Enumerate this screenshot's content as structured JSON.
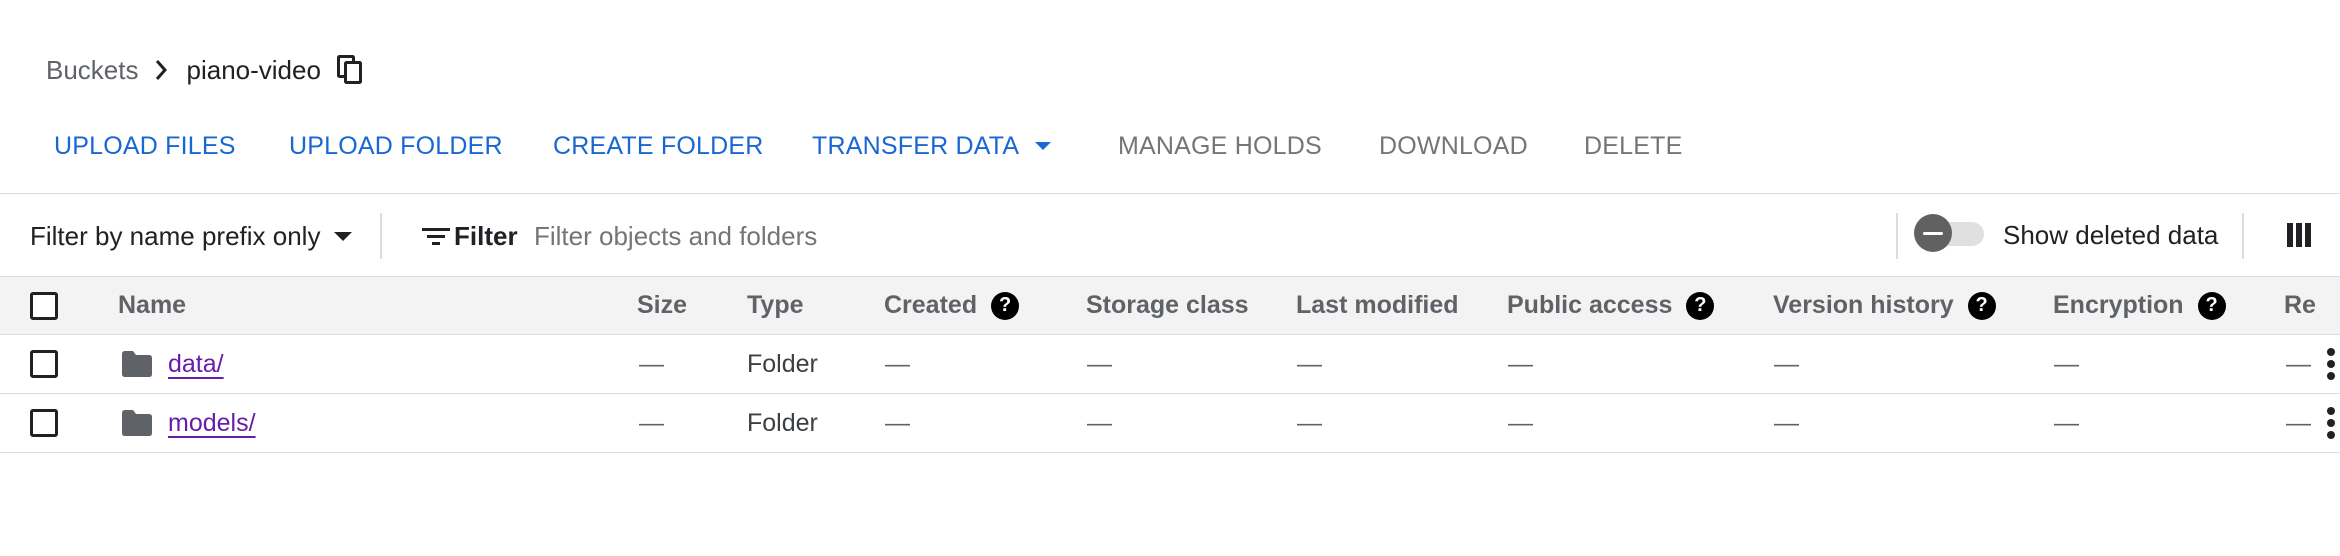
{
  "breadcrumb": {
    "root": "Buckets",
    "current": "piano-video"
  },
  "toolbar": {
    "upload_files": "UPLOAD FILES",
    "upload_folder": "UPLOAD FOLDER",
    "create_folder": "CREATE FOLDER",
    "transfer_data": "TRANSFER DATA",
    "manage_holds": "MANAGE HOLDS",
    "download": "DOWNLOAD",
    "delete": "DELETE"
  },
  "filterbar": {
    "prefix_mode": "Filter by name prefix only",
    "filter_label": "Filter",
    "placeholder": "Filter objects and folders",
    "show_deleted_label": "Show deleted data",
    "show_deleted_on": false
  },
  "table": {
    "columns": {
      "name": "Name",
      "size": "Size",
      "type": "Type",
      "created": "Created",
      "storage_class": "Storage class",
      "last_modified": "Last modified",
      "public_access": "Public access",
      "version_history": "Version history",
      "encryption": "Encryption",
      "retention": "Re"
    },
    "rows": [
      {
        "name": "data/",
        "size": "—",
        "type": "Folder",
        "created": "—",
        "storage_class": "—",
        "last_modified": "—",
        "public_access": "—",
        "version_history": "—",
        "encryption": "—",
        "retention": "—"
      },
      {
        "name": "models/",
        "size": "—",
        "type": "Folder",
        "created": "—",
        "storage_class": "—",
        "last_modified": "—",
        "public_access": "—",
        "version_history": "—",
        "encryption": "—",
        "retention": "—"
      }
    ]
  },
  "icons": {
    "breadcrumb_separator": "chevron-right-icon",
    "copy": "copy-icon",
    "filter": "filter-list-icon",
    "columns": "view-column-icon",
    "help": "help-icon",
    "folder": "folder-icon",
    "row_menu": "more-vert-icon"
  },
  "colors": {
    "primary_action": "#1967d2",
    "disabled_action": "#757575",
    "link_visited": "#681da8",
    "header_bg": "#f3f3f3"
  }
}
